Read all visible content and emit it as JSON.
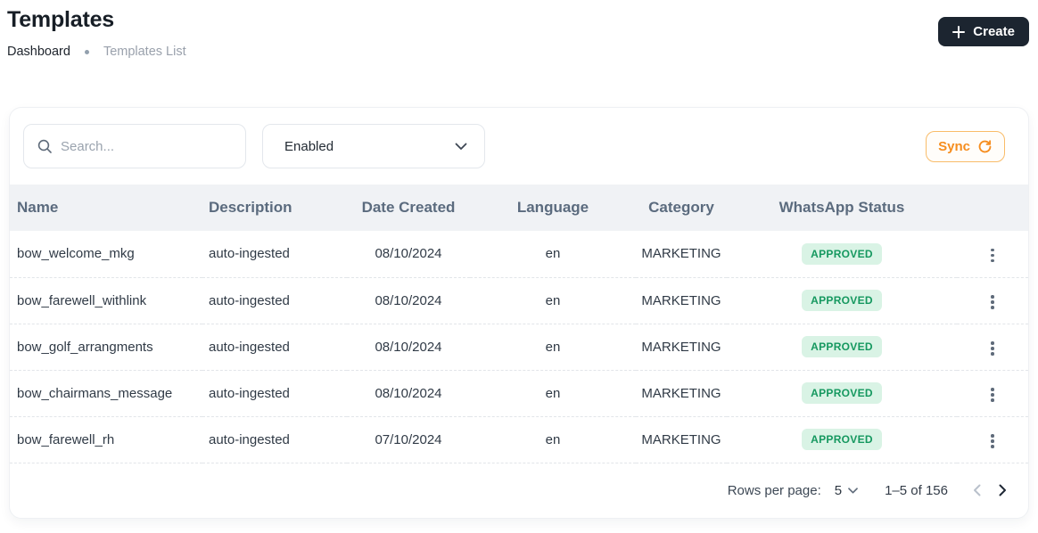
{
  "page": {
    "title": "Templates",
    "breadcrumb": {
      "items": [
        "Dashboard",
        "Templates List"
      ]
    }
  },
  "header": {
    "create_label": "Create"
  },
  "toolbar": {
    "search_placeholder": "Search...",
    "filter_value": "Enabled",
    "sync_label": "Sync"
  },
  "table": {
    "columns": [
      "Name",
      "Description",
      "Date Created",
      "Language",
      "Category",
      "WhatsApp Status"
    ],
    "rows": [
      {
        "name": "bow_welcome_mkg",
        "description": "auto-ingested",
        "date_created": "08/10/2024",
        "language": "en",
        "category": "MARKETING",
        "whatsapp_status": "APPROVED"
      },
      {
        "name": "bow_farewell_withlink",
        "description": "auto-ingested",
        "date_created": "08/10/2024",
        "language": "en",
        "category": "MARKETING",
        "whatsapp_status": "APPROVED"
      },
      {
        "name": "bow_golf_arrangments",
        "description": "auto-ingested",
        "date_created": "08/10/2024",
        "language": "en",
        "category": "MARKETING",
        "whatsapp_status": "APPROVED"
      },
      {
        "name": "bow_chairmans_message",
        "description": "auto-ingested",
        "date_created": "08/10/2024",
        "language": "en",
        "category": "MARKETING",
        "whatsapp_status": "APPROVED"
      },
      {
        "name": "bow_farewell_rh",
        "description": "auto-ingested",
        "date_created": "07/10/2024",
        "language": "en",
        "category": "MARKETING",
        "whatsapp_status": "APPROVED"
      }
    ]
  },
  "pagination": {
    "rows_per_page_label": "Rows per page:",
    "rows_per_page_value": "5",
    "range_label": "1–5 of 156"
  },
  "icons": {
    "create": "plus",
    "search": "magnifier",
    "filter": "chevron-down",
    "sync": "refresh-clockwise",
    "row_menu": "kebab-vertical",
    "prev": "chevron-left",
    "next": "chevron-right"
  },
  "colors": {
    "accent_orange": "#F6921E",
    "sync_border": "#F9BC69",
    "badge_bg": "#D9F3E5",
    "badge_text": "#15985F",
    "create_button_bg": "#1C2530",
    "table_head_bg": "#F0F2F5"
  }
}
